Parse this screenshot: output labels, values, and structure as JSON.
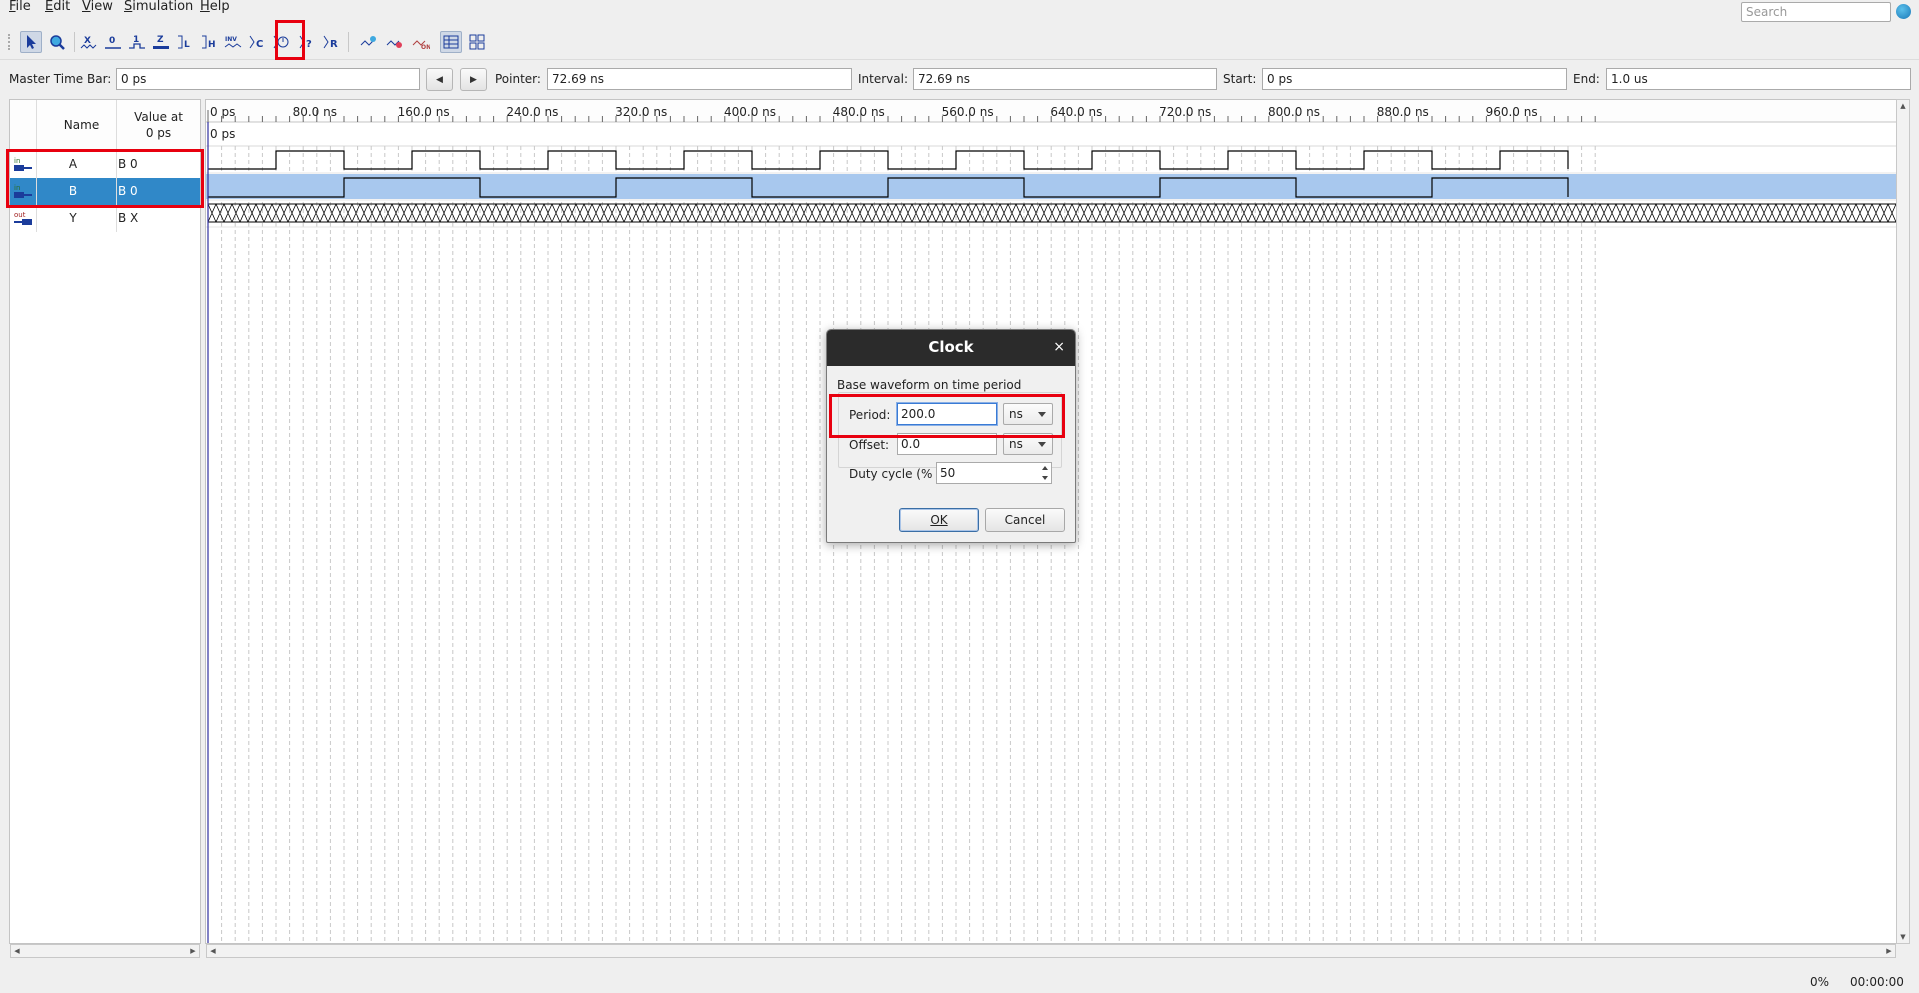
{
  "menu": {
    "items": [
      "File",
      "Edit",
      "View",
      "Simulation",
      "Help"
    ],
    "search_placeholder": "Search"
  },
  "toolbar": {
    "icons": [
      "selection-tool-icon",
      "zoom-tool-icon",
      "uninitialized-icon",
      "forcing-low-icon",
      "forcing-high-icon",
      "high-impedance-icon",
      "weak-low-icon",
      "weak-high-icon",
      "invert-icon",
      "count-value-icon",
      "clock-icon",
      "dont-care-icon",
      "random-value-icon",
      "snap-to-transitions-icon",
      "group-icon",
      "ungroup-icon",
      "sort-icon",
      "display-grid-icon",
      "snap-to-grid-icon"
    ],
    "highlighted": "overwrite-clock-icon"
  },
  "timebar": {
    "master_label": "Master Time Bar:",
    "master_value": "0 ps",
    "pointer_label": "Pointer:",
    "pointer_value": "72.69 ns",
    "interval_label": "Interval:",
    "interval_value": "72.69 ns",
    "start_label": "Start:",
    "start_value": "0 ps",
    "end_label": "End:",
    "end_value": "1.0 us"
  },
  "signals": {
    "header_name": "Name",
    "header_value_line1": "Value at",
    "header_value_line2": "0 ps",
    "rows": [
      {
        "name": "A",
        "value": "B 0",
        "direction": "in",
        "selected": false
      },
      {
        "name": "B",
        "value": "B 0",
        "direction": "in",
        "selected": true
      },
      {
        "name": "Y",
        "value": "B X",
        "direction": "out",
        "selected": false
      }
    ]
  },
  "waveform": {
    "cursor_label": "0 ps",
    "ruler_ticks": [
      "0 ps",
      "80.0 ns",
      "160.0 ns",
      "240.0 ns",
      "320.0 ns",
      "400.0 ns",
      "480.0 ns",
      "560.0 ns",
      "640.0 ns",
      "720.0 ns",
      "800.0 ns",
      "880.0 ns",
      "960.0 ns"
    ],
    "a_period_ns": 100,
    "b_period_ns": 200,
    "y_state": "X",
    "colors": {
      "wave": "#000000",
      "selected_fill": "#a8c8ee",
      "grid": "#c8c8c8",
      "cursor": "#3030a0"
    }
  },
  "dialog": {
    "title": "Clock",
    "close": "×",
    "group_label": "Base waveform on time period",
    "period_label": "Period:",
    "period_value": "200.0",
    "period_unit": "ns",
    "offset_label": "Offset:",
    "offset_value": "0.0",
    "offset_unit": "ns",
    "duty_label": "Duty cycle (%",
    "duty_value": "50",
    "ok": "OK",
    "cancel": "Cancel"
  },
  "status": {
    "progress": "0%",
    "time": "00:00:00"
  },
  "highlight_color": "#e8000f"
}
